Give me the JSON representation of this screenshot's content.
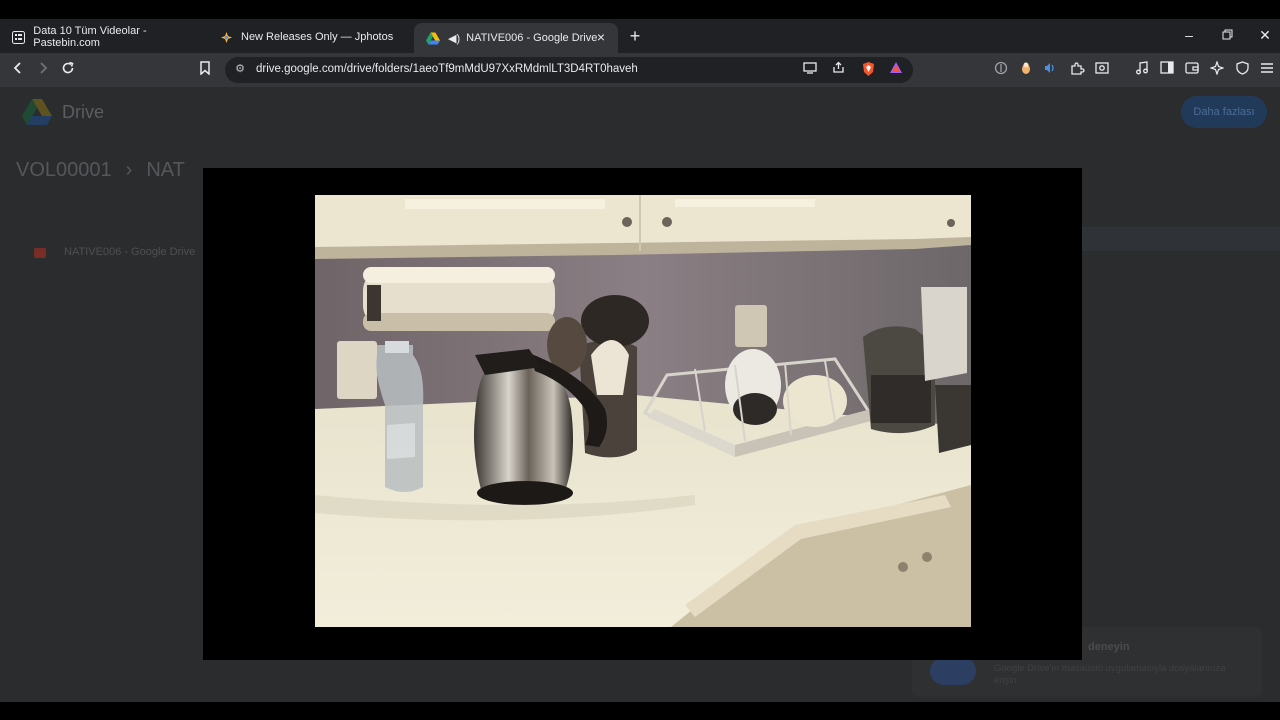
{
  "browser": {
    "tabs": [
      {
        "title": "Data 10 Tüm Videolar - Pastebin.com",
        "favicon": "pastebin-icon",
        "active": false
      },
      {
        "title": "New Releases Only — Jphotos",
        "favicon": "jphotos-icon",
        "active": false
      },
      {
        "title": "NATIVE006 - Google Drive",
        "favicon": "google-drive-icon",
        "active": true,
        "audio": true
      }
    ],
    "address_bar": {
      "url": "drive.google.com/drive/folders/1aeoTf9mMdU97XxRMdmlLT3D4RT0haveh"
    },
    "colors": {
      "tabstrip": "#202124",
      "toolbar": "#35363a",
      "brave_orange": "#fb542b"
    }
  },
  "drive": {
    "app_name": "Drive",
    "breadcrumb": [
      "VOL00001",
      "NAT"
    ],
    "upload_label": "Daha fazlası",
    "file_row": "NATIVE006 - Google Drive",
    "toast_title": "deneyin",
    "toast_body": "Google Drive'ın masaüstü uygulamasıyla dosyalarınıza erişin"
  },
  "video": {
    "content": "kitchen-countertop-scene",
    "colors": {
      "counter": "#ece8d2",
      "cabinet": "#e8e1cc",
      "wall": "#8a7f83"
    }
  }
}
